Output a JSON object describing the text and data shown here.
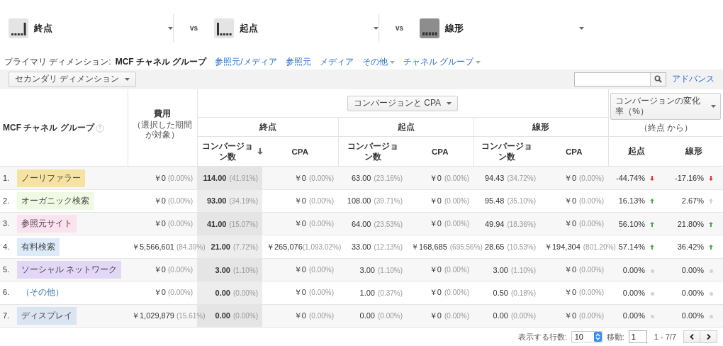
{
  "models": [
    {
      "kind": "last",
      "label": "終点",
      "separator": "vs"
    },
    {
      "kind": "first",
      "label": "起点",
      "separator": "vs"
    },
    {
      "kind": "linear",
      "label": "線形"
    }
  ],
  "primary_dimension": {
    "label": "プライマリ ディメンション:",
    "items": [
      {
        "label": "MCF チャネル グループ",
        "selected": true,
        "dropdown": false
      },
      {
        "label": "参照元/メディア",
        "selected": false,
        "dropdown": false
      },
      {
        "label": "参照元",
        "selected": false,
        "dropdown": false
      },
      {
        "label": "メディア",
        "selected": false,
        "dropdown": false
      },
      {
        "label": "その他",
        "selected": false,
        "dropdown": true
      },
      {
        "label": "チャネル グループ",
        "selected": false,
        "dropdown": true
      }
    ]
  },
  "secondary_dimension": "セカンダリ ディメンション",
  "advanced_link": "アドバンス",
  "table": {
    "name_header": "MCF チャネル グループ",
    "cost_header": "費用",
    "cost_subheader": "（選択した期間が対象）",
    "metric_select": "コンバージョンと CPA",
    "change_select": "コンバージョンの変化率（%）",
    "change_subheader": "（終点 から）",
    "groups": [
      "終点",
      "起点",
      "線形"
    ],
    "columns": [
      {
        "label": "コンバージョン数",
        "sorted": true
      },
      {
        "label": "CPA",
        "sorted": false
      },
      {
        "label": "コンバージョン数",
        "sorted": false
      },
      {
        "label": "CPA",
        "sorted": false
      },
      {
        "label": "コンバージョン数",
        "sorted": false
      },
      {
        "label": "CPA",
        "sorted": false
      }
    ],
    "change_columns": [
      "起点",
      "線形"
    ],
    "rows": [
      {
        "index": "1.",
        "channel": "ノーリファラー",
        "color": "#f7e3a1",
        "cost": "￥0",
        "cost_pct": "(0.00%)",
        "cells": [
          [
            "114.00",
            "(41.91%)"
          ],
          [
            "￥0",
            "(0.00%)"
          ],
          [
            "63.00",
            "(23.16%)"
          ],
          [
            "￥0",
            "(0.00%)"
          ],
          [
            "94.43",
            "(34.72%)"
          ],
          [
            "￥0",
            "(0.00%)"
          ]
        ],
        "changes": [
          {
            "value": "-44.74%",
            "kind": "down"
          },
          {
            "value": "-17.16%",
            "kind": "down"
          }
        ]
      },
      {
        "index": "2.",
        "channel": "オーガニック検索",
        "color": "#f0f9e4",
        "cost": "￥0",
        "cost_pct": "(0.00%)",
        "cells": [
          [
            "93.00",
            "(34.19%)"
          ],
          [
            "￥0",
            "(0.00%)"
          ],
          [
            "108.00",
            "(39.71%)"
          ],
          [
            "￥0",
            "(0.00%)"
          ],
          [
            "95.48",
            "(35.10%)"
          ],
          [
            "￥0",
            "(0.00%)"
          ]
        ],
        "changes": [
          {
            "value": "16.13%",
            "kind": "up"
          },
          {
            "value": "2.67%",
            "kind": "faint"
          }
        ]
      },
      {
        "index": "3.",
        "channel": "参照元サイト",
        "color": "#fbe2ee",
        "cost": "￥0",
        "cost_pct": "(0.00%)",
        "cells": [
          [
            "41.00",
            "(15.07%)"
          ],
          [
            "￥0",
            "(0.00%)"
          ],
          [
            "64.00",
            "(23.53%)"
          ],
          [
            "￥0",
            "(0.00%)"
          ],
          [
            "49.94",
            "(18.36%)"
          ],
          [
            "￥0",
            "(0.00%)"
          ]
        ],
        "changes": [
          {
            "value": "56.10%",
            "kind": "up"
          },
          {
            "value": "21.80%",
            "kind": "up"
          }
        ]
      },
      {
        "index": "4.",
        "channel": "有料検索",
        "color": "#dceaf9",
        "cost": "￥5,566,601",
        "cost_pct": "(84.39%)",
        "cells": [
          [
            "21.00",
            "(7.72%)"
          ],
          [
            "￥265,076",
            "(1,093.02%)"
          ],
          [
            "33.00",
            "(12.13%)"
          ],
          [
            "￥168,685",
            "(695.56%)"
          ],
          [
            "28.65",
            "(10.53%)"
          ],
          [
            "￥194,304",
            "(801.20%)"
          ]
        ],
        "changes": [
          {
            "value": "57.14%",
            "kind": "up"
          },
          {
            "value": "36.42%",
            "kind": "up"
          }
        ]
      },
      {
        "index": "5.",
        "channel": "ソーシャル ネットワーク",
        "color": "#e3d7f6",
        "cost": "￥0",
        "cost_pct": "(0.00%)",
        "cells": [
          [
            "3.00",
            "(1.10%)"
          ],
          [
            "￥0",
            "(0.00%)"
          ],
          [
            "3.00",
            "(1.10%)"
          ],
          [
            "￥0",
            "(0.00%)"
          ],
          [
            "3.00",
            "(1.10%)"
          ],
          [
            "￥0",
            "(0.00%)"
          ]
        ],
        "changes": [
          {
            "value": "0.00%",
            "kind": "flat"
          },
          {
            "value": "0.00%",
            "kind": "flat"
          }
        ]
      },
      {
        "index": "6.",
        "channel": "（その他）",
        "cost": "￥0",
        "cost_pct": "(0.00%)",
        "cells": [
          [
            "0.00",
            "(0.00%)"
          ],
          [
            "￥0",
            "(0.00%)"
          ],
          [
            "1.00",
            "(0.37%)"
          ],
          [
            "￥0",
            "(0.00%)"
          ],
          [
            "0.50",
            "(0.18%)"
          ],
          [
            "￥0",
            "(0.00%)"
          ]
        ],
        "changes": [
          {
            "value": "0.00%",
            "kind": "flat"
          },
          {
            "value": "0.00%",
            "kind": "flat"
          }
        ]
      },
      {
        "index": "7.",
        "channel": "ディスプレイ",
        "color": "#dbe4f1",
        "cost": "￥1,029,879",
        "cost_pct": "(15.61%)",
        "cells": [
          [
            "0.00",
            "(0.00%)"
          ],
          [
            "￥0",
            "(0.00%)"
          ],
          [
            "0.00",
            "(0.00%)"
          ],
          [
            "￥0",
            "(0.00%)"
          ],
          [
            "0.00",
            "(0.00%)"
          ],
          [
            "￥0",
            "(0.00%)"
          ]
        ],
        "changes": [
          {
            "value": "0.00%",
            "kind": "flat"
          },
          {
            "value": "0.00%",
            "kind": "flat"
          }
        ]
      }
    ]
  },
  "pagination": {
    "rows_label": "表示する行数:",
    "rows_value": "10",
    "goto_label": "移動:",
    "goto_value": "1",
    "range": "1 - 7/7"
  }
}
